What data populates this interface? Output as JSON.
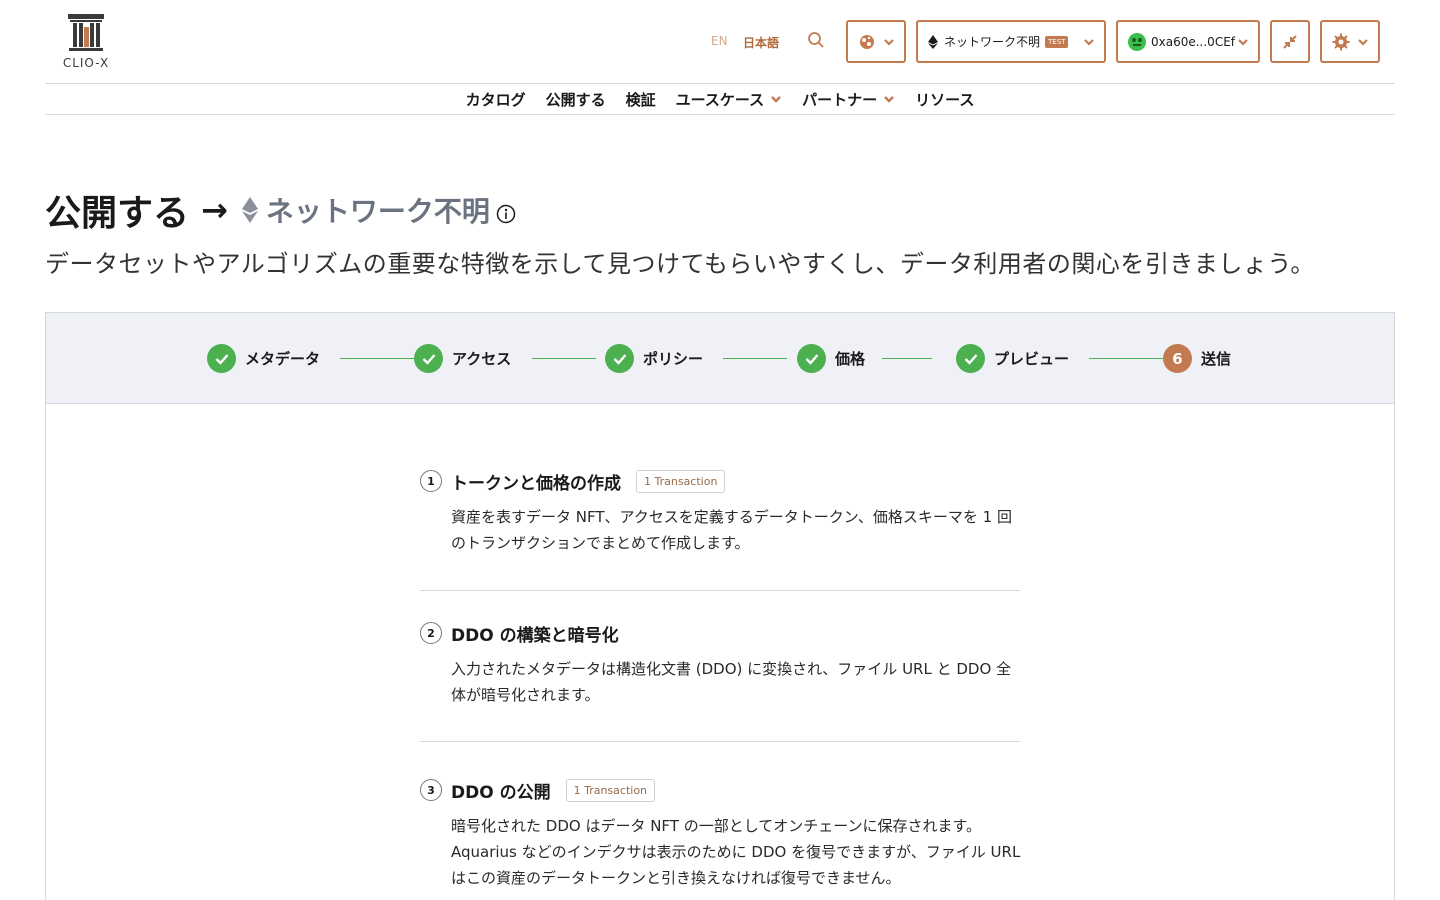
{
  "header": {
    "logo_text": "CLIO-X",
    "lang_en": "EN",
    "lang_ja": "日本語",
    "network_label": "ネットワーク不明",
    "network_badge": "TEST",
    "wallet_address": "0xa60e...0CEf",
    "colors": {
      "accent": "#c47a4f",
      "success": "#4caf50"
    }
  },
  "nav": {
    "items": [
      {
        "label": "カタログ",
        "has_dropdown": false
      },
      {
        "label": "公開する",
        "has_dropdown": false
      },
      {
        "label": "検証",
        "has_dropdown": false
      },
      {
        "label": "ユースケース",
        "has_dropdown": true
      },
      {
        "label": "パートナー",
        "has_dropdown": true
      },
      {
        "label": "リソース",
        "has_dropdown": false
      }
    ]
  },
  "page": {
    "title": "公開する",
    "arrow": "→",
    "network": "ネットワーク不明",
    "subtitle": "データセットやアルゴリズムの重要な特徴を示して見つけてもらいやすくし、データ利用者の関心を引きましょう。"
  },
  "steps": [
    {
      "label": "メタデータ",
      "status": "done",
      "number": "1"
    },
    {
      "label": "アクセス",
      "status": "done",
      "number": "2"
    },
    {
      "label": "ポリシー",
      "status": "done",
      "number": "3"
    },
    {
      "label": "価格",
      "status": "done",
      "number": "4"
    },
    {
      "label": "プレビュー",
      "status": "done",
      "number": "5"
    },
    {
      "label": "送信",
      "status": "active",
      "number": "6"
    }
  ],
  "transactions": [
    {
      "number": "1",
      "title": "トークンと価格の作成",
      "badge": "1 Transaction",
      "description": "資産を表すデータ NFT、アクセスを定義するデータトークン、価格スキーマを 1 回のトランザクションでまとめて作成します。"
    },
    {
      "number": "2",
      "title": "DDO の構築と暗号化",
      "badge": "",
      "description": "入力されたメタデータは構造化文書 (DDO) に変換され、ファイル URL と DDO 全体が暗号化されます。"
    },
    {
      "number": "3",
      "title": "DDO の公開",
      "badge": "1 Transaction",
      "description": "暗号化された DDO はデータ NFT の一部としてオンチェーンに保存されます。Aquarius などのインデクサは表示のために DDO を復号できますが、ファイル URL はこの資産のデータトークンと引き換えなければ復号できません。"
    }
  ]
}
